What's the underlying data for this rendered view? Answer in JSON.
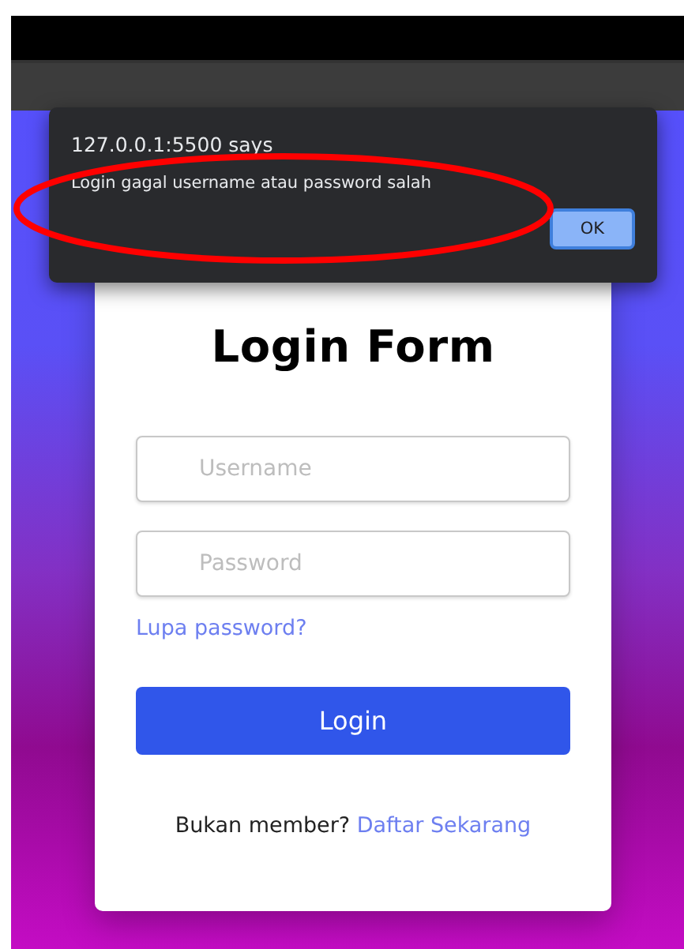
{
  "alert": {
    "origin": "127.0.0.1:5500 says",
    "message": "Login gagal username atau password salah",
    "button": "OK"
  },
  "form": {
    "title": "Login Form",
    "fields": [
      {
        "placeholder": "Username"
      },
      {
        "placeholder": "Password"
      }
    ],
    "forgot_link": "Lupa password?",
    "submit": "Login",
    "footer": {
      "text": "Bukan member?",
      "link": "Daftar Sekarang"
    }
  }
}
